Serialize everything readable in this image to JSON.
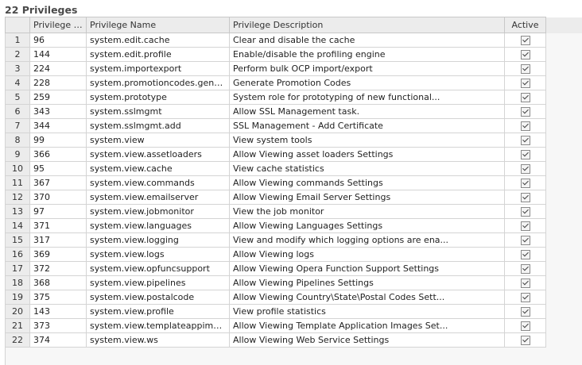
{
  "header": {
    "title": "22 Privileges"
  },
  "columns": {
    "row_num": "",
    "id": "Privilege ID",
    "name": "Privilege Name",
    "description": "Privilege Description",
    "active": "Active"
  },
  "rows": [
    {
      "n": "1",
      "id": "96",
      "name": "system.edit.cache",
      "desc": "Clear and disable the cache",
      "active": true
    },
    {
      "n": "2",
      "id": "144",
      "name": "system.edit.profile",
      "desc": "Enable/disable the profiling engine",
      "active": true
    },
    {
      "n": "3",
      "id": "224",
      "name": "system.importexport",
      "desc": "Perform bulk OCP import/export",
      "active": true
    },
    {
      "n": "4",
      "id": "228",
      "name": "system.promotioncodes.generate",
      "desc": "Generate Promotion Codes",
      "active": true
    },
    {
      "n": "5",
      "id": "259",
      "name": "system.prototype",
      "desc": "System role for prototyping of new functional...",
      "active": true
    },
    {
      "n": "6",
      "id": "343",
      "name": "system.sslmgmt",
      "desc": "Allow SSL Management task.",
      "active": true
    },
    {
      "n": "7",
      "id": "344",
      "name": "system.sslmgmt.add",
      "desc": "SSL Management - Add Certificate",
      "active": true
    },
    {
      "n": "8",
      "id": "99",
      "name": "system.view",
      "desc": "View system tools",
      "active": true
    },
    {
      "n": "9",
      "id": "366",
      "name": "system.view.assetloaders",
      "desc": "Allow Viewing asset loaders Settings",
      "active": true
    },
    {
      "n": "10",
      "id": "95",
      "name": "system.view.cache",
      "desc": "View cache statistics",
      "active": true
    },
    {
      "n": "11",
      "id": "367",
      "name": "system.view.commands",
      "desc": "Allow Viewing commands Settings",
      "active": true
    },
    {
      "n": "12",
      "id": "370",
      "name": "system.view.emailserver",
      "desc": "Allow Viewing Email Server Settings",
      "active": true
    },
    {
      "n": "13",
      "id": "97",
      "name": "system.view.jobmonitor",
      "desc": "View the job monitor",
      "active": true
    },
    {
      "n": "14",
      "id": "371",
      "name": "system.view.languages",
      "desc": "Allow Viewing Languages Settings",
      "active": true
    },
    {
      "n": "15",
      "id": "317",
      "name": "system.view.logging",
      "desc": "View and modify which logging options are ena...",
      "active": true
    },
    {
      "n": "16",
      "id": "369",
      "name": "system.view.logs",
      "desc": "Allow Viewing logs",
      "active": true
    },
    {
      "n": "17",
      "id": "372",
      "name": "system.view.opfuncsupport",
      "desc": "Allow Viewing Opera Function Support Settings",
      "active": true
    },
    {
      "n": "18",
      "id": "368",
      "name": "system.view.pipelines",
      "desc": "Allow Viewing Pipelines Settings",
      "active": true
    },
    {
      "n": "19",
      "id": "375",
      "name": "system.view.postalcode",
      "desc": "Allow Viewing Country\\State\\Postal Codes Sett...",
      "active": true
    },
    {
      "n": "20",
      "id": "143",
      "name": "system.view.profile",
      "desc": "View profile statistics",
      "active": true
    },
    {
      "n": "21",
      "id": "373",
      "name": "system.view.templateappimages",
      "desc": "Allow Viewing Template Application Images Set...",
      "active": true
    },
    {
      "n": "22",
      "id": "374",
      "name": "system.view.ws",
      "desc": "Allow Viewing Web Service Settings",
      "active": true
    }
  ]
}
